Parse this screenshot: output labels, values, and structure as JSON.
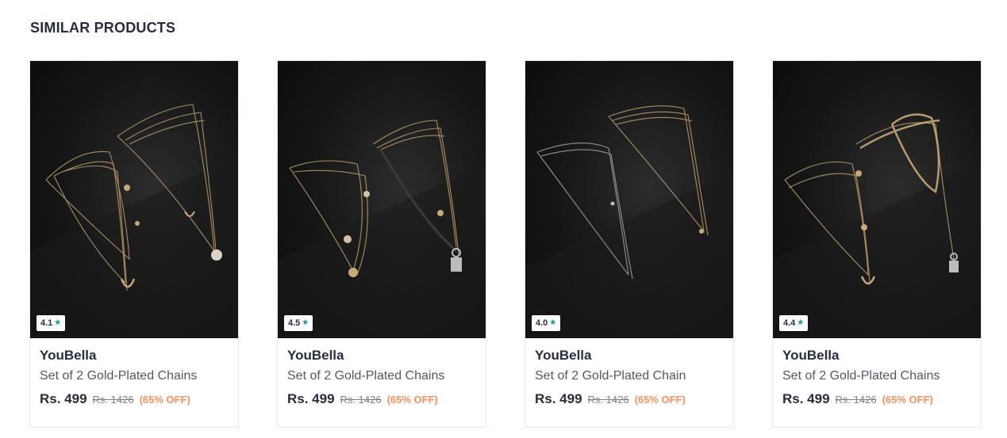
{
  "section": {
    "title": "SIMILAR PRODUCTS"
  },
  "products": [
    {
      "brand": "YouBella",
      "name": "Set of 2 Gold-Plated Chains",
      "price": "Rs. 499",
      "mrp": "Rs. 1426",
      "discount": "(65% OFF)",
      "rating": "4.1",
      "icon": "star-icon"
    },
    {
      "brand": "YouBella",
      "name": "Set of 2 Gold-Plated Chains",
      "price": "Rs. 499",
      "mrp": "Rs. 1426",
      "discount": "(65% OFF)",
      "rating": "4.5",
      "icon": "star-icon"
    },
    {
      "brand": "YouBella",
      "name": "Set of 2 Gold-Plated Chain",
      "price": "Rs. 499",
      "mrp": "Rs. 1426",
      "discount": "(65% OFF)",
      "rating": "4.0",
      "icon": "star-icon"
    },
    {
      "brand": "YouBella",
      "name": "Set of 2 Gold-Plated Chains",
      "price": "Rs. 499",
      "mrp": "Rs. 1426",
      "discount": "(65% OFF)",
      "rating": "4.4",
      "icon": "star-icon"
    }
  ],
  "colors": {
    "rating_star": "#14958f",
    "discount": "#ff905a",
    "text_primary": "#282c3f"
  }
}
